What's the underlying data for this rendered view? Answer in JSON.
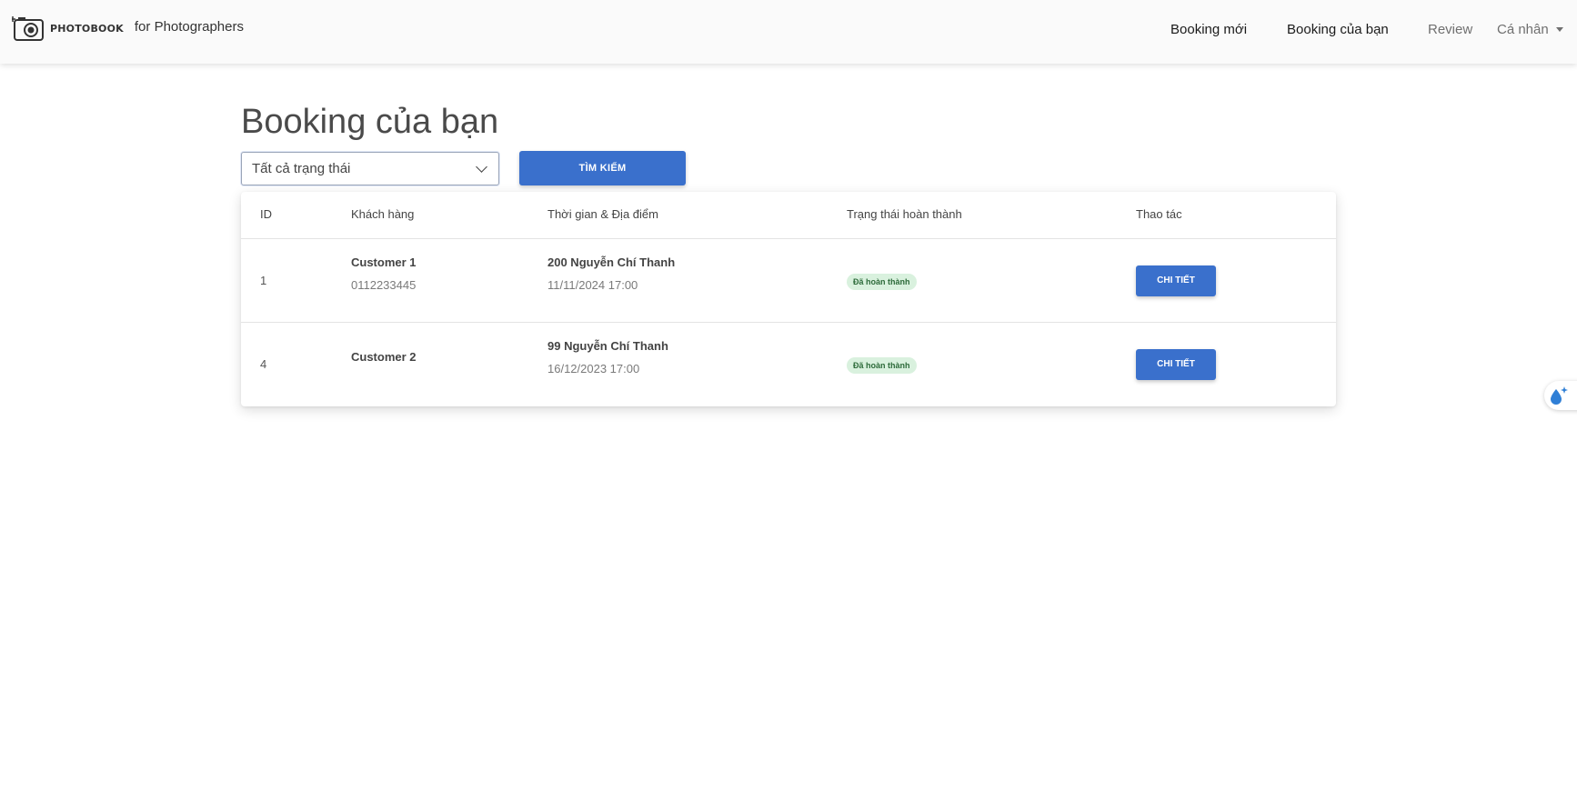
{
  "brand": {
    "logo_text": "PHOTOBOOK",
    "subtitle": "for Photographers"
  },
  "nav": {
    "items": [
      {
        "label": "Booking mới"
      },
      {
        "label": "Booking của bạn"
      },
      {
        "label": "Review"
      },
      {
        "label": "Cá nhân"
      }
    ]
  },
  "page": {
    "title": "Booking của bạn"
  },
  "filter": {
    "selected": "Tất cả trạng thái",
    "search_label": "TÌM KIẾM"
  },
  "table": {
    "columns": [
      "ID",
      "Khách hàng",
      "Thời gian & Địa điểm",
      "Trạng thái hoàn thành",
      "Thao tác"
    ],
    "rows": [
      {
        "id": "1",
        "customer": "Customer 1",
        "phone": "0112233445",
        "location": "200 Nguyễn Chí Thanh",
        "time": "11/11/2024 17:00",
        "status": "Đã hoàn thành",
        "action": "CHI TIẾT"
      },
      {
        "id": "4",
        "customer": "Customer 2",
        "phone": "",
        "location": "99 Nguyễn Chí Thanh",
        "time": "16/12/2023 17:00",
        "status": "Đã hoàn thành",
        "action": "CHI TIẾT"
      }
    ]
  },
  "colors": {
    "primary": "#3a70cc",
    "badge_bg": "#d9f1de",
    "badge_text": "#2d6b3a"
  },
  "icons": {
    "logo": "camera-icon",
    "dropdown": "chevron-down-icon",
    "widget": "droplet-sparkle-icon"
  }
}
